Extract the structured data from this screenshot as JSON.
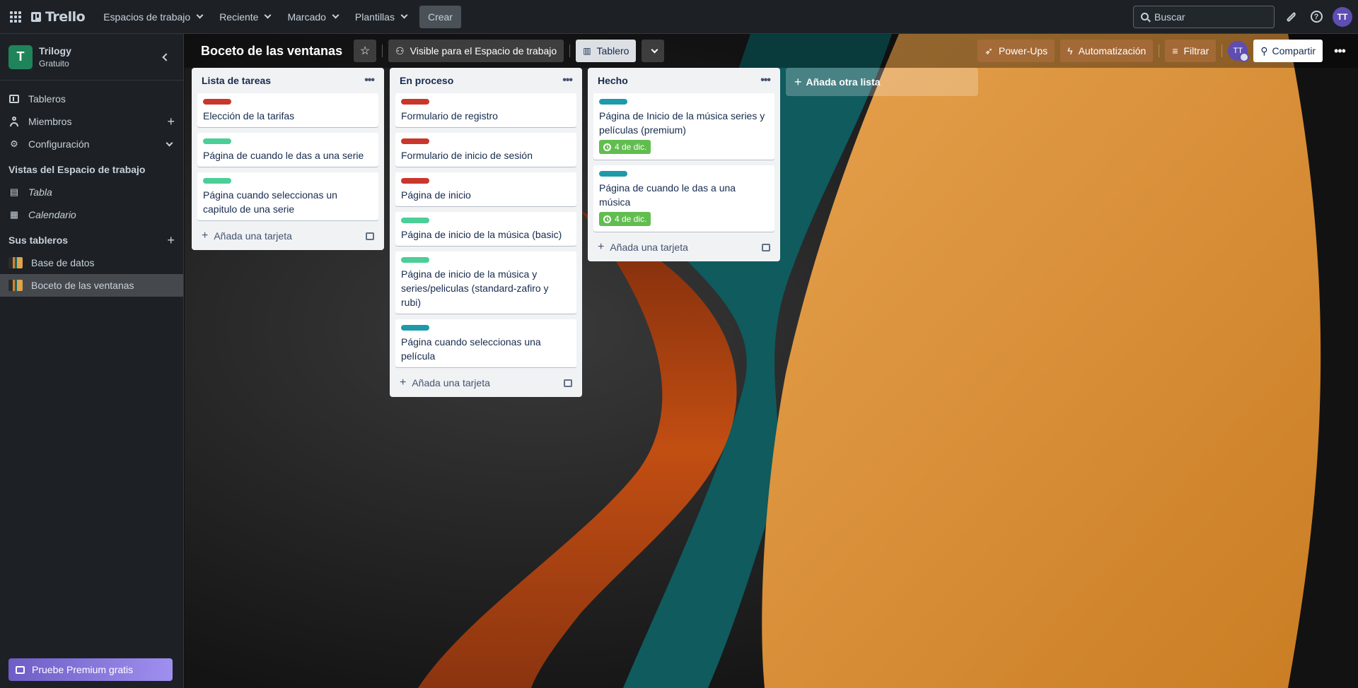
{
  "topbar": {
    "logo": "Trello",
    "nav": [
      {
        "label": "Espacios de trabajo"
      },
      {
        "label": "Reciente"
      },
      {
        "label": "Marcado"
      },
      {
        "label": "Plantillas"
      }
    ],
    "create_label": "Crear",
    "search_placeholder": "Buscar",
    "avatar": "TT"
  },
  "sidebar": {
    "workspace_initial": "T",
    "workspace_name": "Trilogy",
    "workspace_plan": "Gratuito",
    "items": [
      {
        "label": "Tableros"
      },
      {
        "label": "Miembros"
      },
      {
        "label": "Configuración"
      }
    ],
    "views_heading": "Vistas del Espacio de trabajo",
    "views": [
      {
        "label": "Tabla"
      },
      {
        "label": "Calendario"
      }
    ],
    "boards_heading": "Sus tableros",
    "boards": [
      {
        "label": "Base de datos"
      },
      {
        "label": "Boceto de las ventanas"
      }
    ],
    "premium_label": "Pruebe Premium gratis"
  },
  "board": {
    "title": "Boceto de las ventanas",
    "visibility": "Visible para el Espacio de trabajo",
    "view": "Tablero",
    "powerups": "Power-Ups",
    "automation": "Automatización",
    "filter": "Filtrar",
    "member_avatar": "TT",
    "share": "Compartir",
    "add_list": "Añada otra lista",
    "add_card": "Añada una tarjeta",
    "lists": [
      {
        "title": "Lista de tareas",
        "cards": [
          {
            "label_color": "#c9372c",
            "title": "Elección de la tarifas"
          },
          {
            "label_color": "#4bce97",
            "title": "Página de cuando le das a una serie"
          },
          {
            "label_color": "#4bce97",
            "title": "Página cuando seleccionas un capitulo de una serie"
          }
        ]
      },
      {
        "title": "En proceso",
        "cards": [
          {
            "label_color": "#c9372c",
            "title": "Formulario de registro"
          },
          {
            "label_color": "#c9372c",
            "title": "Formulario de inicio de sesión"
          },
          {
            "label_color": "#c9372c",
            "title": "Página de inicio"
          },
          {
            "label_color": "#4bce97",
            "title": "Página de inicio de la música (basic)"
          },
          {
            "label_color": "#4bce97",
            "title": "Página de inicio de la música y series/peliculas (standard-zafiro y rubi)"
          },
          {
            "label_color": "#1d9aaa",
            "title": "Página cuando seleccionas una película"
          }
        ]
      },
      {
        "title": "Hecho",
        "cards": [
          {
            "label_color": "#1d9aaa",
            "title": "Página de Inicio de la música series y películas (premium)",
            "due": "4 de dic."
          },
          {
            "label_color": "#1d9aaa",
            "title": "Página de cuando le das a una música",
            "due": "4 de dic."
          }
        ]
      }
    ]
  }
}
